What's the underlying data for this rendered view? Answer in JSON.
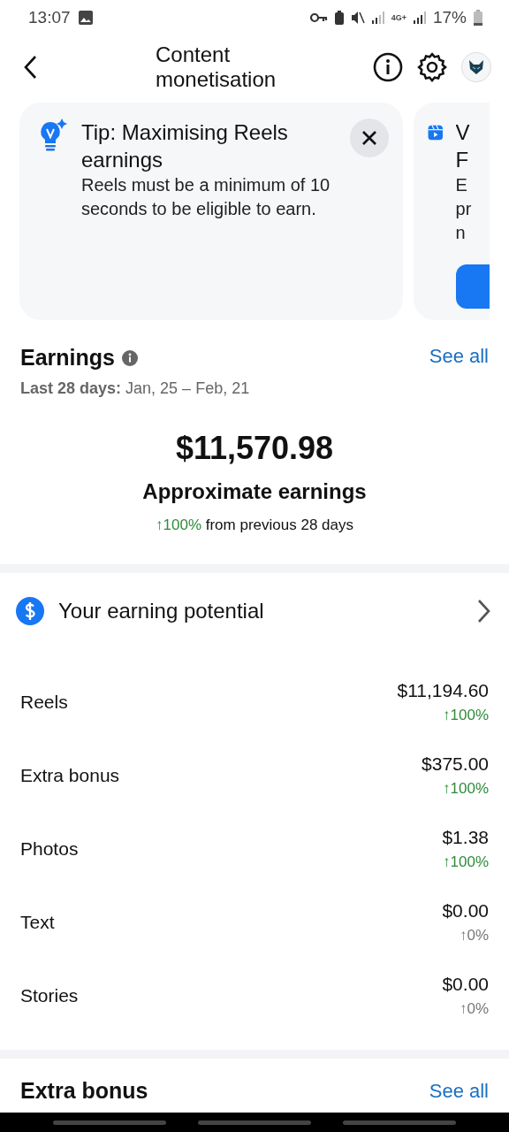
{
  "status_bar": {
    "time": "13:07",
    "network": "4G+",
    "battery": "17%"
  },
  "header": {
    "title": "Content monetisation"
  },
  "cards": [
    {
      "kind": "tip",
      "title": "Tip: Maximising Reels earnings",
      "body": "Reels must be a minimum of 10 seconds to be eligible to earn."
    },
    {
      "kind": "promo",
      "title_lines": [
        "V",
        "F"
      ],
      "body_lines": [
        "E",
        "pr",
        "n"
      ]
    }
  ],
  "earnings": {
    "title": "Earnings",
    "see_all": "See all",
    "period_label": "Last 28 days:",
    "period": "Jan, 25 – Feb, 21",
    "total": "$11,570.98",
    "caption": "Approximate earnings",
    "change": "↑100%",
    "change_note": "from previous 28 days"
  },
  "potential": {
    "title": "Your earning potential",
    "rows": [
      {
        "label": "Reels",
        "amount": "$11,194.60",
        "change": "↑100%",
        "positive": true
      },
      {
        "label": "Extra bonus",
        "amount": "$375.00",
        "change": "↑100%",
        "positive": true
      },
      {
        "label": "Photos",
        "amount": "$1.38",
        "change": "↑100%",
        "positive": true
      },
      {
        "label": "Text",
        "amount": "$0.00",
        "change": "↑0%",
        "positive": false
      },
      {
        "label": "Stories",
        "amount": "$0.00",
        "change": "↑0%",
        "positive": false
      }
    ]
  },
  "extra_bonus": {
    "title": "Extra bonus",
    "see_all": "See all"
  }
}
